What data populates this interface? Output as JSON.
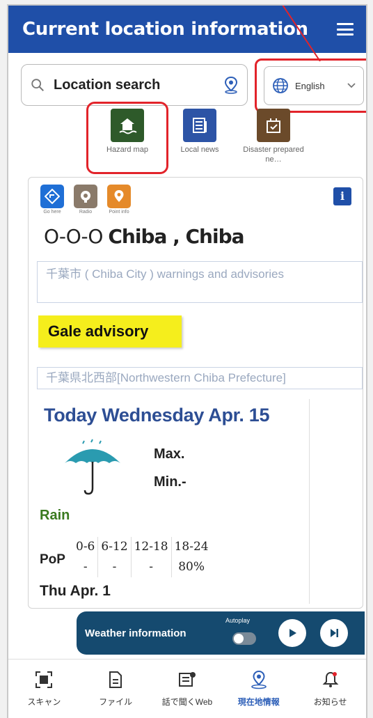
{
  "header": {
    "title": "Current location information"
  },
  "search": {
    "placeholder": "Location search"
  },
  "language": {
    "selected": "English"
  },
  "shortcuts": [
    {
      "label": "Hazard map",
      "color": "#2e5a2a",
      "icon": "hazard-map-icon"
    },
    {
      "label": "Local news",
      "color": "#2d54a6",
      "icon": "news-icon"
    },
    {
      "label": "Disaster prepared ne…",
      "color": "#6b4a2a",
      "icon": "disaster-prep-icon"
    }
  ],
  "layers": [
    {
      "caption": "Go here",
      "color": "#1f6fd6",
      "icon": "navigation-icon"
    },
    {
      "caption": "Radio",
      "color": "#8a7a6a",
      "icon": "radio-icon"
    },
    {
      "caption": "Point info",
      "color": "#e58a2a",
      "icon": "point-icon"
    }
  ],
  "location": {
    "prefix": "O-O-O",
    "name": "Chiba , Chiba"
  },
  "warnings": {
    "city_header": "千葉市 ( Chiba City ) warnings and advisories",
    "advisory": "Gale advisory",
    "region_header": "千葉県北西部[Northwestern Chiba Prefecture]"
  },
  "forecast": {
    "date": "Today Wednesday Apr. 15",
    "weather_icon": "umbrella-icon",
    "max_label": "Max.",
    "min_label": "Min.-",
    "condition": "Rain",
    "pop_label": "PoP",
    "pop": [
      {
        "range": "0-6",
        "value": "-"
      },
      {
        "range": "6-12",
        "value": "-"
      },
      {
        "range": "12-18",
        "value": "-"
      },
      {
        "range": "18-24",
        "value": "80%"
      }
    ],
    "next_day": "Thu Apr. 1"
  },
  "weather_bar": {
    "label": "Weather information",
    "autoplay_label": "Autoplay"
  },
  "bottom_nav": [
    {
      "label": "スキャン",
      "icon": "scan-icon",
      "active": false
    },
    {
      "label": "ファイル",
      "icon": "file-icon",
      "active": false
    },
    {
      "label": "話で聞くWeb",
      "icon": "listen-web-icon",
      "active": false
    },
    {
      "label": "現在地情報",
      "icon": "location-info-icon",
      "active": true
    },
    {
      "label": "お知らせ",
      "icon": "notification-bell-icon",
      "active": false
    }
  ],
  "colors": {
    "primary": "#1f4fa8",
    "highlight": "#e2232a",
    "advisory": "#f5ee1c",
    "rain": "#3a7a1f"
  }
}
